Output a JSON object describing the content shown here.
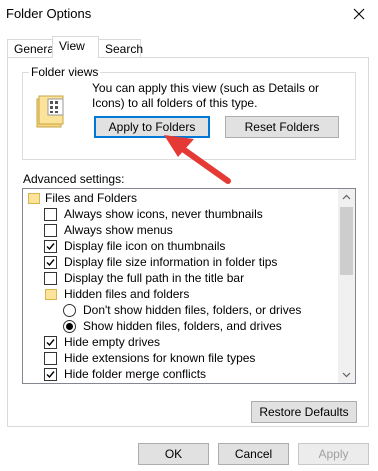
{
  "window": {
    "title": "Folder Options"
  },
  "tabs": [
    {
      "label": "General",
      "active": false
    },
    {
      "label": "View",
      "active": true
    },
    {
      "label": "Search",
      "active": false
    }
  ],
  "folder_views": {
    "group_label": "Folder views",
    "description": "You can apply this view (such as Details or Icons) to all folders of this type.",
    "apply_button": "Apply to Folders",
    "reset_button": "Reset Folders"
  },
  "advanced": {
    "label": "Advanced settings:",
    "items": [
      {
        "type": "folder",
        "label": "Files and Folders"
      },
      {
        "type": "checkbox",
        "label": "Always show icons, never thumbnails",
        "checked": false
      },
      {
        "type": "checkbox",
        "label": "Always show menus",
        "checked": false
      },
      {
        "type": "checkbox",
        "label": "Display file icon on thumbnails",
        "checked": true
      },
      {
        "type": "checkbox",
        "label": "Display file size information in folder tips",
        "checked": true
      },
      {
        "type": "checkbox",
        "label": "Display the full path in the title bar",
        "checked": false
      },
      {
        "type": "folder",
        "label": "Hidden files and folders"
      },
      {
        "type": "radio",
        "label": "Don't show hidden files, folders, or drives",
        "checked": false
      },
      {
        "type": "radio",
        "label": "Show hidden files, folders, and drives",
        "checked": true
      },
      {
        "type": "checkbox",
        "label": "Hide empty drives",
        "checked": true
      },
      {
        "type": "checkbox",
        "label": "Hide extensions for known file types",
        "checked": false
      },
      {
        "type": "checkbox",
        "label": "Hide folder merge conflicts",
        "checked": true
      }
    ]
  },
  "restore_defaults": "Restore Defaults",
  "dialog_buttons": {
    "ok": "OK",
    "cancel": "Cancel",
    "apply": "Apply"
  },
  "annotation": {
    "color": "#e53935"
  }
}
